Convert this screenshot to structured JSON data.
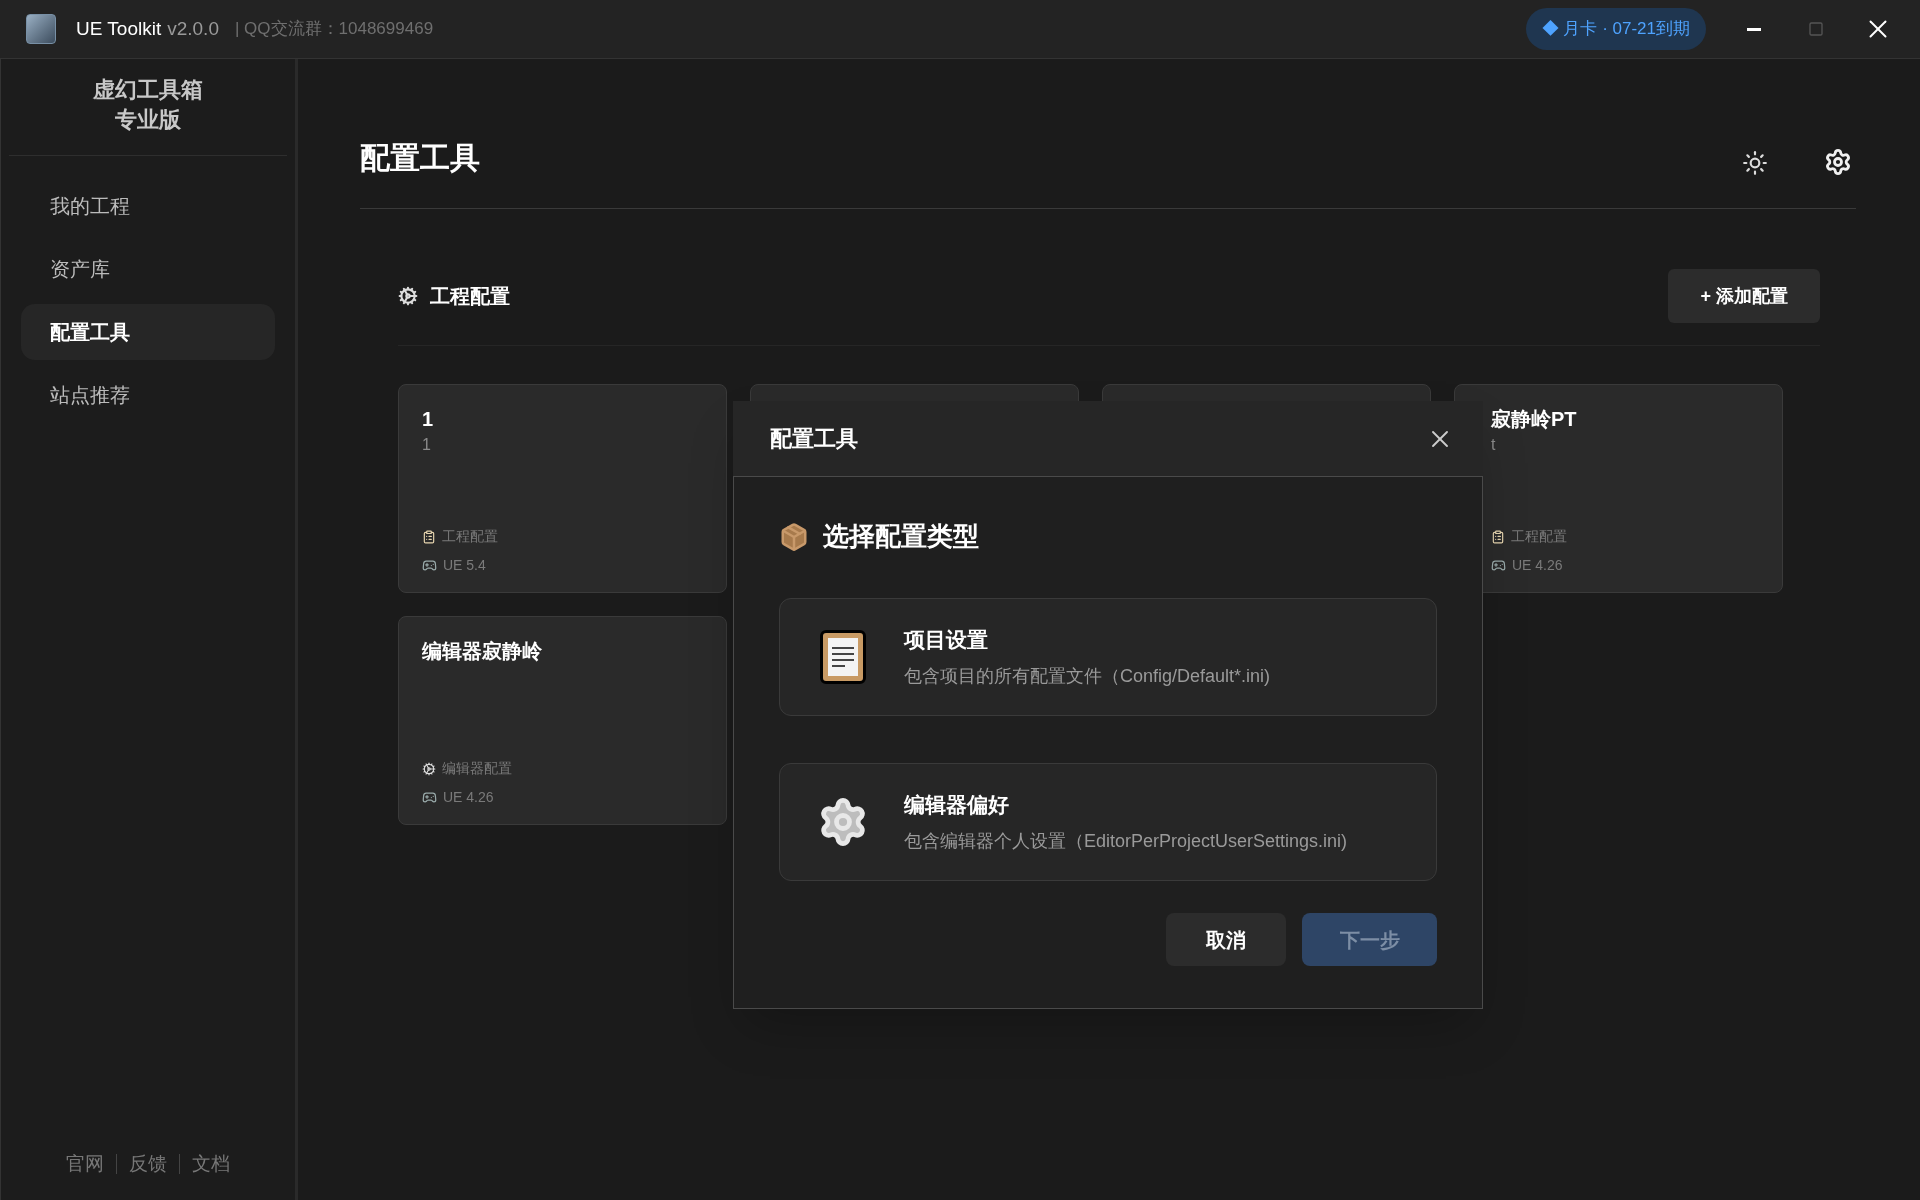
{
  "window": {
    "app_name": "UE Toolkit",
    "version": "v2.0.0",
    "group": "| QQ交流群：1048699469",
    "badge": "◆ 月卡 · 07-21到期"
  },
  "sidebar": {
    "title": "虚幻工具箱",
    "subtitle": "专业版",
    "items": [
      {
        "label": "我的工程",
        "selected": false
      },
      {
        "label": "资产库",
        "selected": false
      },
      {
        "label": "配置工具",
        "selected": true
      },
      {
        "label": "站点推荐",
        "selected": false
      }
    ],
    "footer_links": [
      "官网",
      "反馈",
      "文档"
    ]
  },
  "page": {
    "title": "配置工具"
  },
  "section": {
    "title": "工程配置",
    "add_button": "+ 添加配置"
  },
  "cards": [
    {
      "title": "1",
      "subtitle": "1",
      "kind": "project",
      "type_label": "工程配置",
      "engine": "UE 5.4"
    },
    {
      "kind": "hidden"
    },
    {
      "kind": "hidden"
    },
    {
      "title": "寂静岭PT",
      "subtitle": "t",
      "kind": "project",
      "type_label": "工程配置",
      "engine": "UE 4.26"
    },
    {
      "title": "编辑器寂静岭",
      "kind": "editor",
      "type_label": "编辑器配置",
      "engine": "UE 4.26"
    }
  ],
  "dialog": {
    "title": "配置工具",
    "heading": "选择配置类型",
    "options": [
      {
        "kind": "project",
        "title": "项目设置",
        "description": "包含项目的所有配置文件（Config/Default*.ini)",
        "selected": false
      },
      {
        "kind": "editor",
        "title": "编辑器偏好",
        "description": "包含编辑器个人设置（EditorPerProjectUserSettings.ini)",
        "selected": false
      }
    ],
    "cancel": "取消",
    "next": {
      "label": "下一步",
      "disabled": true
    }
  }
}
